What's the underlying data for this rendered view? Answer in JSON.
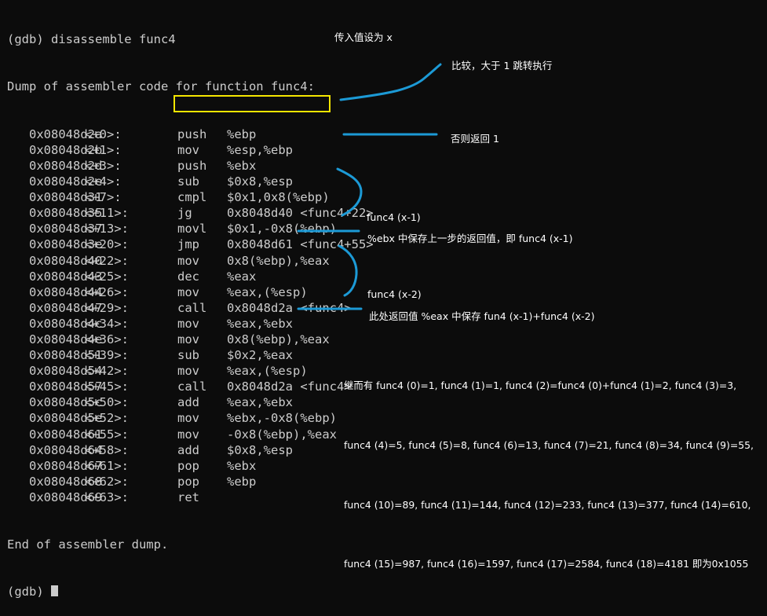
{
  "terminal": {
    "command": "(gdb) disassemble func4",
    "dump_header": "Dump of assembler code for function func4:",
    "rows": [
      {
        "addr": "0x08048d2a",
        "off": "<+0>:",
        "op": "push",
        "args": "%ebp"
      },
      {
        "addr": "0x08048d2b",
        "off": "<+1>:",
        "op": "mov",
        "args": "%esp,%ebp"
      },
      {
        "addr": "0x08048d2d",
        "off": "<+3>:",
        "op": "push",
        "args": "%ebx"
      },
      {
        "addr": "0x08048d2e",
        "off": "<+4>:",
        "op": "sub",
        "args": "$0x8,%esp"
      },
      {
        "addr": "0x08048d31",
        "off": "<+7>:",
        "op": "cmpl",
        "args": "$0x1,0x8(%ebp)"
      },
      {
        "addr": "0x08048d35",
        "off": "<+11>:",
        "op": "jg",
        "args": "0x8048d40 <func4+22>"
      },
      {
        "addr": "0x08048d37",
        "off": "<+13>:",
        "op": "movl",
        "args": "$0x1,-0x8(%ebp)"
      },
      {
        "addr": "0x08048d3e",
        "off": "<+20>:",
        "op": "jmp",
        "args": "0x8048d61 <func4+55>"
      },
      {
        "addr": "0x08048d40",
        "off": "<+22>:",
        "op": "mov",
        "args": "0x8(%ebp),%eax"
      },
      {
        "addr": "0x08048d43",
        "off": "<+25>:",
        "op": "dec",
        "args": "%eax"
      },
      {
        "addr": "0x08048d44",
        "off": "<+26>:",
        "op": "mov",
        "args": "%eax,(%esp)"
      },
      {
        "addr": "0x08048d47",
        "off": "<+29>:",
        "op": "call",
        "args": "0x8048d2a <func4>"
      },
      {
        "addr": "0x08048d4c",
        "off": "<+34>:",
        "op": "mov",
        "args": "%eax,%ebx"
      },
      {
        "addr": "0x08048d4e",
        "off": "<+36>:",
        "op": "mov",
        "args": "0x8(%ebp),%eax"
      },
      {
        "addr": "0x08048d51",
        "off": "<+39>:",
        "op": "sub",
        "args": "$0x2,%eax"
      },
      {
        "addr": "0x08048d54",
        "off": "<+42>:",
        "op": "mov",
        "args": "%eax,(%esp)"
      },
      {
        "addr": "0x08048d57",
        "off": "<+45>:",
        "op": "call",
        "args": "0x8048d2a <func4>"
      },
      {
        "addr": "0x08048d5c",
        "off": "<+50>:",
        "op": "add",
        "args": "%eax,%ebx"
      },
      {
        "addr": "0x08048d5e",
        "off": "<+52>:",
        "op": "mov",
        "args": "%ebx,-0x8(%ebp)"
      },
      {
        "addr": "0x08048d61",
        "off": "<+55>:",
        "op": "mov",
        "args": "-0x8(%ebp),%eax"
      },
      {
        "addr": "0x08048d64",
        "off": "<+58>:",
        "op": "add",
        "args": "$0x8,%esp"
      },
      {
        "addr": "0x08048d67",
        "off": "<+61>:",
        "op": "pop",
        "args": "%ebx"
      },
      {
        "addr": "0x08048d68",
        "off": "<+62>:",
        "op": "pop",
        "args": "%ebp"
      },
      {
        "addr": "0x08048d69",
        "off": "<+63>:",
        "op": "ret",
        "args": ""
      }
    ],
    "dump_footer": "End of assembler dump.",
    "prompt": "(gdb) "
  },
  "annotations": {
    "input_x": "传入值设为 x",
    "compare": "比较，大于 1 跳转执行",
    "else_return": "否则返回 1",
    "call1": "func4 (x-1)",
    "ebx_save": "%ebx 中保存上一步的返回值，即 func4 (x-1)",
    "call2": "func4 (x-2)",
    "return_here": "此处返回值 %eax 中保存 fun4 (x-1)+func4 (x-2)",
    "summary": [
      "继而有 func4 (0)=1, func4 (1)=1, func4 (2)=func4 (0)+func4 (1)=2, func4 (3)=3,",
      "func4 (4)=5, func4 (5)=8, func4 (6)=13, func4 (7)=21, func4 (8)=34, func4 (9)=55,",
      "func4 (10)=89, func4 (11)=144, func4 (12)=233, func4 (13)=377, func4 (14)=610,",
      "func4 (15)=987, func4 (16)=1597, func4 (17)=2584, func4 (18)=4181 即为0x1055"
    ]
  },
  "colors": {
    "background": "#0c0c0c",
    "terminal_text": "#cccccc",
    "highlight_box": "#f5e600",
    "annotation_stroke": "#1c9ad6",
    "annotation_text": "#ffffff"
  }
}
